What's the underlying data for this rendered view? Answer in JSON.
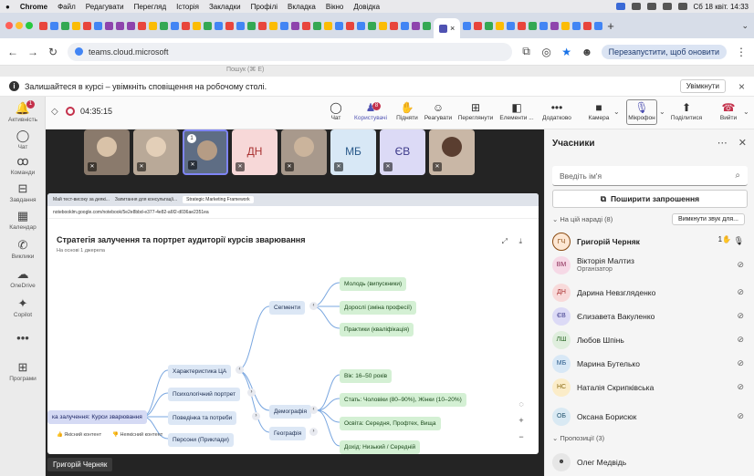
{
  "menubar": {
    "app": "Chrome",
    "items": [
      "Файл",
      "Редагувати",
      "Перегляд",
      "Історія",
      "Закладки",
      "Профілі",
      "Вкладка",
      "Вікно",
      "Довідка"
    ],
    "clock": "Сб 18 квіт. 14:33"
  },
  "browser": {
    "url": "teams.cloud.microsoft",
    "restart_label": "Перезапустити, щоб оновити",
    "new_tab": "+",
    "close_tab": "×"
  },
  "teams": {
    "search_placeholder": "Пошук (⌘ E)"
  },
  "notification": {
    "text": "Залишайтеся в курсі – увімкніть сповіщення на робочому столі.",
    "button": "Увімкнути",
    "close": "×"
  },
  "rail": [
    {
      "label": "Активність",
      "icon": "🔔",
      "badge": "1"
    },
    {
      "label": "Чат",
      "icon": "💬"
    },
    {
      "label": "Команди",
      "icon": "👥"
    },
    {
      "label": "Завдання",
      "icon": "📋"
    },
    {
      "label": "Календар",
      "icon": "📅"
    },
    {
      "label": "Виклики",
      "icon": "📞"
    },
    {
      "label": "OneDrive",
      "icon": "☁"
    },
    {
      "label": "Copilot",
      "icon": "✦"
    },
    {
      "label": "",
      "icon": "•••"
    },
    {
      "label": "Програми",
      "icon": "⊞"
    }
  ],
  "meeting": {
    "timer": "04:35:15",
    "toolbar": [
      {
        "label": "Чат",
        "icon": "💬"
      },
      {
        "label": "Користувачі",
        "icon": "👥",
        "badge": "8"
      },
      {
        "label": "Підняти",
        "icon": "✋"
      },
      {
        "label": "Реагувати",
        "icon": "☺"
      },
      {
        "label": "Переглянути",
        "icon": "⊞"
      },
      {
        "label": "Елементи ...",
        "icon": "◧"
      },
      {
        "label": "Додатково",
        "icon": "•••"
      },
      {
        "label": "Камера",
        "icon": "■"
      },
      {
        "label": "Мікрофон",
        "icon": "🎙"
      },
      {
        "label": "Поділитися",
        "icon": "⬆"
      },
      {
        "label": "Вийти",
        "icon": "☎"
      }
    ],
    "tiles": [
      {
        "type": "photo",
        "color": "#8a7a6c"
      },
      {
        "type": "photo",
        "color": "#b9a998"
      },
      {
        "type": "photo",
        "color": "#5e6d84",
        "badge": "1"
      },
      {
        "type": "initials",
        "initials": "ДН",
        "bg": "#f7d8d8",
        "fg": "#a33"
      },
      {
        "type": "photo",
        "color": "#a8998c"
      },
      {
        "type": "initials",
        "initials": "МБ",
        "bg": "#d8e8f6",
        "fg": "#2a5a8a"
      },
      {
        "type": "initials",
        "initials": "ЄВ",
        "bg": "#dcdaf6",
        "fg": "#3d3a8a"
      },
      {
        "type": "photo",
        "color": "#c9b7a6"
      }
    ],
    "presenter": "Григорій Черняк"
  },
  "shared": {
    "tabs": [
      "Май тест-високу за деякі...",
      "Запитання для консультації...",
      "Strategic Marketing Framework"
    ],
    "url": "notebooklm.google.com/notebook/5e2e8bbd-e377-4e82-a6f2-d036ae2351ea",
    "title": "Стратегія залучення та портрет аудиторії курсів зварювання",
    "subtitle": "На основі 1 джерела",
    "root": "ка залучення: Курси зварювання",
    "l1": [
      "Характеристика ЦА",
      "Психологічний портрет",
      "Поведінка та потреби",
      "Персони (Приклади)"
    ],
    "l2": [
      "Сегменти",
      "Демографія",
      "Географія"
    ],
    "l3_seg": [
      "Молодь (випускники)",
      "Дорослі (зміна професії)",
      "Практики (кваліфікація)"
    ],
    "l3_demo": [
      "Вік: 16–50 років",
      "Стать: Чоловіки (80–90%), Жінки (10–20%)",
      "Освіта: Середня, Профтех, Вища",
      "Дохід: Низький / Середній"
    ],
    "good": "Якісний контент",
    "bad": "Неякісний контент",
    "zoom_in": "+",
    "zoom_out": "−"
  },
  "panel": {
    "title": "Учасники",
    "search_placeholder": "Введіть ім'я",
    "invite": "Поширити запрошення",
    "in_meeting": "На цій нараді (8)",
    "mute_all": "Вимкнути звук для...",
    "participants": [
      {
        "initials": "ГЧ",
        "name": "Григорій Черняк",
        "role": "",
        "bg": "#fde7d3",
        "fg": "#8a4b12",
        "bold": true
      },
      {
        "initials": "ВМ",
        "name": "Вікторія Малтиз",
        "role": "Організатор",
        "bg": "#f6d9e6",
        "fg": "#8a2a55"
      },
      {
        "initials": "ДН",
        "name": "Дарина Невзгляденко",
        "role": "",
        "bg": "#f8dada",
        "fg": "#a33"
      },
      {
        "initials": "ЄВ",
        "name": "Єлизавета Вакуленко",
        "role": "",
        "bg": "#dcdaf6",
        "fg": "#3d3a8a"
      },
      {
        "initials": "ЛШ",
        "name": "Любов Шпінь",
        "role": "",
        "bg": "#dfeedd",
        "fg": "#2f6b2a"
      },
      {
        "initials": "МБ",
        "name": "Марина Бутелько",
        "role": "",
        "bg": "#d8e8f6",
        "fg": "#2a5a8a"
      },
      {
        "initials": "НС",
        "name": "Наталія Скрипківська",
        "role": "",
        "bg": "#fbecc8",
        "fg": "#8a6a12"
      },
      {
        "initials": "ОБ",
        "name": "Оксана Борисюк",
        "role": "",
        "bg": "#d9e9f3",
        "fg": "#24546f"
      }
    ],
    "proposed": "Пропозиції (3)",
    "proposed_person": "Олег Медвідь"
  }
}
